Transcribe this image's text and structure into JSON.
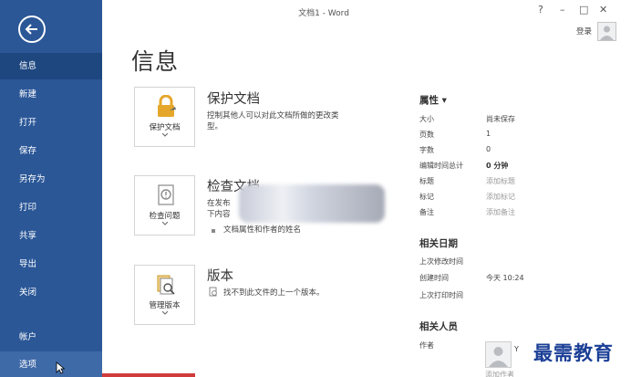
{
  "window": {
    "title": "文档1 - Word",
    "help_glyph": "?",
    "minimize_glyph": "–",
    "restore_glyph": "□",
    "close_glyph": "✕",
    "signin": "登录"
  },
  "nav": {
    "items": [
      "信息",
      "新建",
      "打开",
      "保存",
      "另存为",
      "打印",
      "共享",
      "导出",
      "关闭",
      "帐户",
      "选项"
    ],
    "active": "信息"
  },
  "page": {
    "title": "信息"
  },
  "sections": {
    "protect": {
      "button_label": "保护文档",
      "heading": "保护文档",
      "description_1": "控制其他人可以对此文档所做的更改类",
      "description_2": "型。"
    },
    "inspect": {
      "button_label": "检查问题",
      "heading": "检查文档",
      "line_1": "在发布",
      "line_2": "下内容",
      "bullet": "文档属性和作者的姓名"
    },
    "versions": {
      "button_label": "管理版本",
      "heading": "版本",
      "description": "找不到此文件的上一个版本。"
    }
  },
  "properties": {
    "heading": "属性 ▾",
    "rows": [
      {
        "label": "大小",
        "value": "尚未保存"
      },
      {
        "label": "页数",
        "value": "1"
      },
      {
        "label": "字数",
        "value": "0"
      },
      {
        "label": "编辑时间总计",
        "value": "0 分钟"
      },
      {
        "label": "标题",
        "value": "添加标题"
      },
      {
        "label": "标记",
        "value": "添加标记"
      },
      {
        "label": "备注",
        "value": "添加备注"
      }
    ],
    "dates": {
      "heading": "相关日期",
      "last_modified": "上次修改时间",
      "created": "创建时间",
      "created_value": "今天 10:24",
      "last_printed": "上次打印时间"
    },
    "people": {
      "heading": "相关人员",
      "author_label": "作者",
      "author_partial": "Y",
      "add_author": "添加作者"
    }
  },
  "watermark": "最需教育",
  "colors": {
    "rail": "#2b5797",
    "active_item": "#1e4780",
    "icon_gold": "#e5a72b",
    "watermark": "#1b3f96"
  }
}
